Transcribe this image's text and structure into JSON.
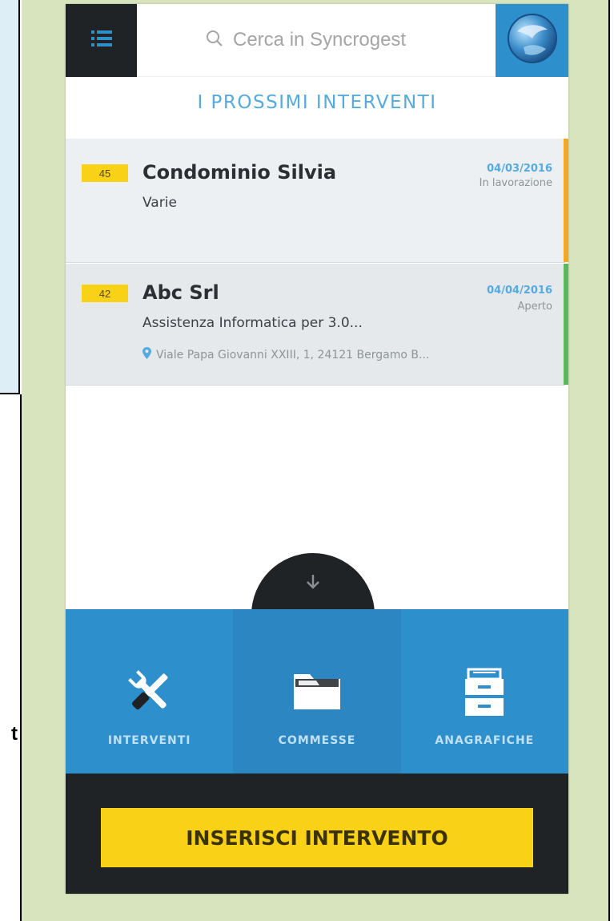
{
  "document": {
    "left_fragment_char": "t"
  },
  "app": {
    "search": {
      "placeholder": "Cerca in Syncrogest",
      "value": ""
    },
    "section_title": "I PROSSIMI INTERVENTI",
    "interventions": [
      {
        "number": "45",
        "title": "Condominio Silvia",
        "subtitle": "Varie",
        "date": "04/03/2016",
        "status": "In lavorazione",
        "status_color": "#f5a623",
        "address": ""
      },
      {
        "number": "42",
        "title": "Abc Srl",
        "subtitle": "Assistenza Informatica per 3.0...",
        "date": "04/04/2016",
        "status": "Aperto",
        "status_color": "#5cb85c",
        "address": "Viale Papa Giovanni XXIII, 1, 24121 Bergamo B..."
      }
    ],
    "nav": [
      {
        "label": "INTERVENTI",
        "icon": "tools-icon"
      },
      {
        "label": "COMMESSE",
        "icon": "folder-icon"
      },
      {
        "label": "ANAGRAFICHE",
        "icon": "archive-drawer-icon"
      }
    ],
    "cta_label": "INSERISCI INTERVENTO",
    "colors": {
      "accent_blue": "#2e8fcd",
      "title_blue": "#54abe0",
      "dark": "#1f2326",
      "yellow": "#f9d117"
    }
  }
}
